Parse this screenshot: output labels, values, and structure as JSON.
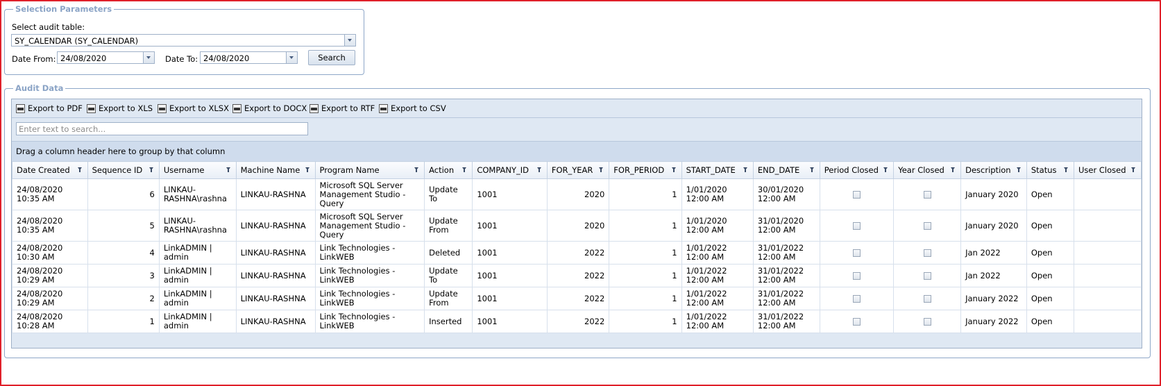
{
  "selection": {
    "legend": "Selection Parameters",
    "audit_table_label": "Select audit table:",
    "audit_table_value": "SY_CALENDAR (SY_CALENDAR)",
    "date_from_label": "Date From:",
    "date_from_value": "24/08/2020",
    "date_to_label": "Date To:",
    "date_to_value": "24/08/2020",
    "search_button": "Search"
  },
  "audit": {
    "legend": "Audit Data",
    "toolbar": [
      {
        "label": "Export to PDF",
        "icon": "pdf-icon"
      },
      {
        "label": "Export to XLS",
        "icon": "xls-icon"
      },
      {
        "label": "Export to XLSX",
        "icon": "xlsx-icon"
      },
      {
        "label": "Export to DOCX",
        "icon": "docx-icon"
      },
      {
        "label": "Export to RTF",
        "icon": "rtf-icon"
      },
      {
        "label": "Export to CSV",
        "icon": "csv-icon"
      }
    ],
    "search_placeholder": "Enter text to search...",
    "group_panel_text": "Drag a column header here to group by that column",
    "columns": [
      "Date Created",
      "Sequence ID",
      "Username",
      "Machine Name",
      "Program Name",
      "Action",
      "COMPANY_ID",
      "FOR_YEAR",
      "FOR_PERIOD",
      "START_DATE",
      "END_DATE",
      "Period Closed",
      "Year Closed",
      "Description",
      "Status",
      "User Closed"
    ],
    "rows": [
      {
        "date_created": [
          "24/08/2020",
          "10:35 AM"
        ],
        "sequence_id": "6",
        "username": [
          "LINKAU-",
          "RASHNA\\rashna"
        ],
        "machine": "LINKAU-RASHNA",
        "program": [
          "Microsoft SQL Server",
          "Management Studio -",
          "Query"
        ],
        "action": [
          "Update To"
        ],
        "company_id": "1001",
        "for_year": "2020",
        "for_period": "1",
        "start_date": [
          "1/01/2020",
          "12:00 AM"
        ],
        "end_date": [
          "30/01/2020",
          "12:00 AM"
        ],
        "description": "January 2020",
        "status": "Open",
        "user_closed": ""
      },
      {
        "date_created": [
          "24/08/2020",
          "10:35 AM"
        ],
        "sequence_id": "5",
        "username": [
          "LINKAU-",
          "RASHNA\\rashna"
        ],
        "machine": "LINKAU-RASHNA",
        "program": [
          "Microsoft SQL Server",
          "Management Studio -",
          "Query"
        ],
        "action": [
          "Update",
          "From"
        ],
        "company_id": "1001",
        "for_year": "2020",
        "for_period": "1",
        "start_date": [
          "1/01/2020",
          "12:00 AM"
        ],
        "end_date": [
          "31/01/2020",
          "12:00 AM"
        ],
        "description": "January 2020",
        "status": "Open",
        "user_closed": ""
      },
      {
        "date_created": [
          "24/08/2020",
          "10:30 AM"
        ],
        "sequence_id": "4",
        "username": [
          "LinkADMIN |",
          "admin"
        ],
        "machine": "LINKAU-RASHNA",
        "program": [
          "Link Technologies -",
          "LinkWEB"
        ],
        "action": [
          "Deleted"
        ],
        "company_id": "1001",
        "for_year": "2022",
        "for_period": "1",
        "start_date": [
          "1/01/2022",
          "12:00 AM"
        ],
        "end_date": [
          "31/01/2022",
          "12:00 AM"
        ],
        "description": "Jan 2022",
        "status": "Open",
        "user_closed": ""
      },
      {
        "date_created": [
          "24/08/2020",
          "10:29 AM"
        ],
        "sequence_id": "3",
        "username": [
          "LinkADMIN |",
          "admin"
        ],
        "machine": "LINKAU-RASHNA",
        "program": [
          "Link Technologies -",
          "LinkWEB"
        ],
        "action": [
          "Update To"
        ],
        "company_id": "1001",
        "for_year": "2022",
        "for_period": "1",
        "start_date": [
          "1/01/2022",
          "12:00 AM"
        ],
        "end_date": [
          "31/01/2022",
          "12:00 AM"
        ],
        "description": "Jan 2022",
        "status": "Open",
        "user_closed": ""
      },
      {
        "date_created": [
          "24/08/2020",
          "10:29 AM"
        ],
        "sequence_id": "2",
        "username": [
          "LinkADMIN |",
          "admin"
        ],
        "machine": "LINKAU-RASHNA",
        "program": [
          "Link Technologies -",
          "LinkWEB"
        ],
        "action": [
          "Update",
          "From"
        ],
        "company_id": "1001",
        "for_year": "2022",
        "for_period": "1",
        "start_date": [
          "1/01/2022",
          "12:00 AM"
        ],
        "end_date": [
          "31/01/2022",
          "12:00 AM"
        ],
        "description": "January 2022",
        "status": "Open",
        "user_closed": ""
      },
      {
        "date_created": [
          "24/08/2020",
          "10:28 AM"
        ],
        "sequence_id": "1",
        "username": [
          "LinkADMIN |",
          "admin"
        ],
        "machine": "LINKAU-RASHNA",
        "program": [
          "Link Technologies -",
          "LinkWEB"
        ],
        "action": [
          "Inserted"
        ],
        "company_id": "1001",
        "for_year": "2022",
        "for_period": "1",
        "start_date": [
          "1/01/2022",
          "12:00 AM"
        ],
        "end_date": [
          "31/01/2022",
          "12:00 AM"
        ],
        "description": "January 2022",
        "status": "Open",
        "user_closed": ""
      }
    ]
  }
}
